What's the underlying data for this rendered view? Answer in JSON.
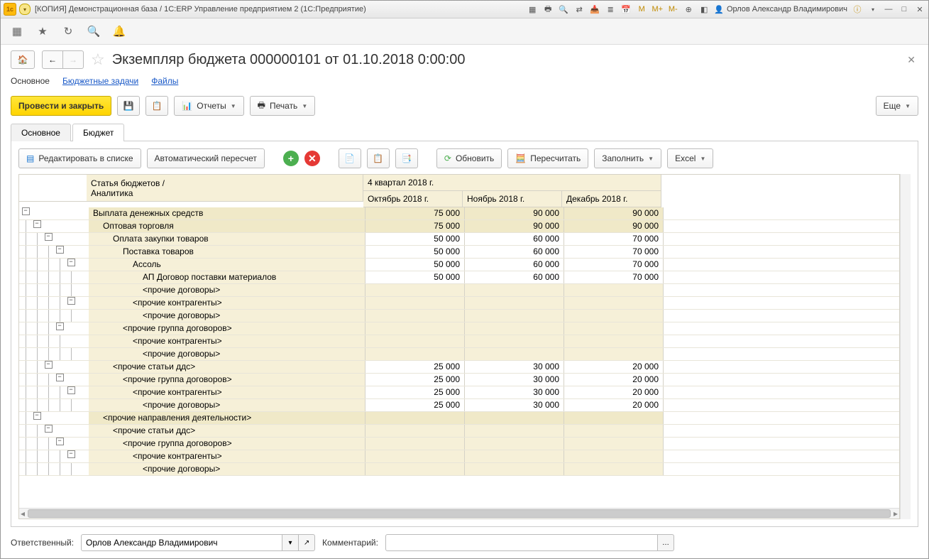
{
  "titlebar": {
    "title": "[КОПИЯ] Демонстрационная база / 1C:ERP Управление предприятием 2  (1С:Предприятие)",
    "user": "Орлов Александр Владимирович"
  },
  "page": {
    "title": "Экземпляр бюджета 000000101 от 01.10.2018 0:00:00"
  },
  "nav_links": {
    "main": "Основное",
    "tasks": "Бюджетные задачи",
    "files": "Файлы"
  },
  "actions": {
    "post_close": "Провести и закрыть",
    "reports": "Отчеты",
    "print": "Печать",
    "more": "Еще"
  },
  "tabs": {
    "main": "Основное",
    "budget": "Бюджет"
  },
  "panel_tb": {
    "edit_list": "Редактировать в списке",
    "auto_recalc": "Автоматический пересчет",
    "refresh": "Обновить",
    "recalc": "Пересчитать",
    "fill": "Заполнить",
    "excel": "Excel"
  },
  "grid": {
    "h_art_line1": "Статья бюджетов /",
    "h_art_line2": "Аналитика",
    "h_q": "4 квартал 2018 г.",
    "h_m1": "Октябрь 2018 г.",
    "h_m2": "Ноябрь 2018 г.",
    "h_m3": "Декабрь 2018 г.",
    "rows": [
      {
        "lvl": 0,
        "exp": "-",
        "name": "Выплата денежных средств",
        "v": [
          "75 000",
          "90 000",
          "90 000"
        ],
        "shade": 1,
        "bold": 1
      },
      {
        "lvl": 1,
        "exp": "-",
        "name": "Оптовая торговля",
        "v": [
          "75 000",
          "90 000",
          "90 000"
        ],
        "shade": 1
      },
      {
        "lvl": 2,
        "exp": "-",
        "name": "Оплата закупки товаров",
        "v": [
          "50 000",
          "60 000",
          "70 000"
        ],
        "shade": 0
      },
      {
        "lvl": 3,
        "exp": "-",
        "name": "Поставка товаров",
        "v": [
          "50 000",
          "60 000",
          "70 000"
        ],
        "shade": 0
      },
      {
        "lvl": 4,
        "exp": "-",
        "name": "Ассоль",
        "v": [
          "50 000",
          "60 000",
          "70 000"
        ],
        "shade": 0
      },
      {
        "lvl": 5,
        "exp": "",
        "name": "АП Договор поставки материалов",
        "v": [
          "50 000",
          "60 000",
          "70 000"
        ],
        "shade": 0
      },
      {
        "lvl": 5,
        "exp": "",
        "name": "<прочие договоры>",
        "v": [
          "",
          "",
          ""
        ],
        "shade": 0
      },
      {
        "lvl": 4,
        "exp": "-",
        "name": "<прочие контрагенты>",
        "v": [
          "",
          "",
          ""
        ],
        "shade": 0
      },
      {
        "lvl": 5,
        "exp": "",
        "name": "<прочие договоры>",
        "v": [
          "",
          "",
          ""
        ],
        "shade": 0
      },
      {
        "lvl": 3,
        "exp": "-",
        "name": "<прочие группа договоров>",
        "v": [
          "",
          "",
          ""
        ],
        "shade": 0
      },
      {
        "lvl": 4,
        "exp": "",
        "name": "<прочие контрагенты>",
        "v": [
          "",
          "",
          ""
        ],
        "shade": 0
      },
      {
        "lvl": 5,
        "exp": "",
        "name": "<прочие договоры>",
        "v": [
          "",
          "",
          ""
        ],
        "shade": 0
      },
      {
        "lvl": 2,
        "exp": "-",
        "name": "<прочие статьи ддс>",
        "v": [
          "25 000",
          "30 000",
          "20 000"
        ],
        "shade": 0
      },
      {
        "lvl": 3,
        "exp": "-",
        "name": "<прочие группа договоров>",
        "v": [
          "25 000",
          "30 000",
          "20 000"
        ],
        "shade": 0
      },
      {
        "lvl": 4,
        "exp": "-",
        "name": "<прочие контрагенты>",
        "v": [
          "25 000",
          "30 000",
          "20 000"
        ],
        "shade": 0
      },
      {
        "lvl": 5,
        "exp": "",
        "name": "<прочие договоры>",
        "v": [
          "25 000",
          "30 000",
          "20 000"
        ],
        "shade": 0
      },
      {
        "lvl": 1,
        "exp": "-",
        "name": "<прочие направления деятельности>",
        "v": [
          "",
          "",
          ""
        ],
        "shade": 1
      },
      {
        "lvl": 2,
        "exp": "-",
        "name": "<прочие статьи ддс>",
        "v": [
          "",
          "",
          ""
        ],
        "shade": 0
      },
      {
        "lvl": 3,
        "exp": "-",
        "name": "<прочие группа договоров>",
        "v": [
          "",
          "",
          ""
        ],
        "shade": 0
      },
      {
        "lvl": 4,
        "exp": "-",
        "name": "<прочие контрагенты>",
        "v": [
          "",
          "",
          ""
        ],
        "shade": 0
      },
      {
        "lvl": 5,
        "exp": "",
        "name": "<прочие договоры>",
        "v": [
          "",
          "",
          ""
        ],
        "shade": 0
      }
    ]
  },
  "footer": {
    "resp_label": "Ответственный:",
    "resp_value": "Орлов Александр Владимирович",
    "comment_label": "Комментарий:",
    "comment_value": ""
  }
}
